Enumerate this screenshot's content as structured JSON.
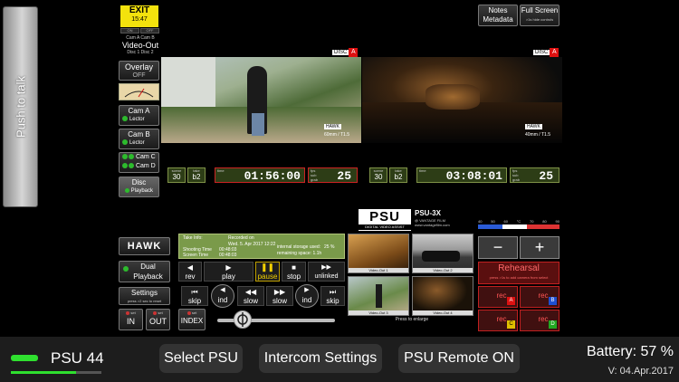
{
  "ptt": {
    "label": "Push to talk"
  },
  "exit": {
    "label": "EXIT",
    "time": "15:47",
    "toggles": [
      "ON",
      "OFF"
    ]
  },
  "notes_button": {
    "line1": "Notes",
    "line2": "Metadata"
  },
  "fullscreen_button": {
    "line1": "Full Screen",
    "line2": ">1s hide controls"
  },
  "left_panel": {
    "camhdr": {
      "line1": "Cam A  Cam B",
      "line2": "Video-Out",
      "line3": "Disc 1   Disc 2"
    },
    "overlay": {
      "label": "Overlay",
      "state": "OFF"
    },
    "cam_a": {
      "label": "Cam A",
      "sub": "Lector"
    },
    "cam_b": {
      "label": "Cam B",
      "sub": "Lector"
    },
    "cam_cd": {
      "c": "Cam C",
      "d": "Cam D"
    },
    "disc": {
      "label": "Disc",
      "sub": "Playback"
    }
  },
  "videos": {
    "left": {
      "disc_label": "DISC",
      "disc_letter": "A",
      "lens": "60mm / T1.5",
      "brand": "HAWK"
    },
    "right": {
      "disc_label": "DISC",
      "disc_letter": "A",
      "lens": "40mm / T1.5",
      "brand": "HAWK"
    }
  },
  "tc_left": {
    "scene_label": "scene",
    "scene": "30",
    "take_label": "take",
    "take": "b2",
    "time_label": "time",
    "timecode": "01:56:00",
    "fps_label": "fps",
    "fps_sub": "sub",
    "fps_sub2": "grab",
    "fps": "25"
  },
  "tc_right": {
    "scene_label": "scene",
    "scene": "30",
    "take_label": "take",
    "take": "b2",
    "time_label": "time",
    "timecode": "03:08:01",
    "fps_label": "fps",
    "fps_sub": "sub",
    "fps_sub2": "grab",
    "fps": "25"
  },
  "psu_logo": {
    "brand": "PSU",
    "sub": "DIGITAL VIDEO ASSIST",
    "model": "PSU-3X",
    "by": "@ VANTAGE FILM",
    "url": "www.vantagefilm.com"
  },
  "temp_scale": {
    "ticks": [
      "40",
      "50",
      "60",
      "°C",
      "70",
      "80",
      "90"
    ]
  },
  "take_info": {
    "title": "Take Info:",
    "recorded_on": "Recorded on",
    "date": "Wed. 5. Apr 2017  12:22",
    "shooting_label": "Shooting Time",
    "shooting": "00:48:03",
    "screen_label": "Screen Time",
    "screen": "00:48:03",
    "storage_label": "internal storage used:",
    "storage": "25 %",
    "storage_remain": "remaining space: 1.1h"
  },
  "hawk_button": {
    "label": "HAWK"
  },
  "dual_playback": {
    "line1": "Dual",
    "line2": "Playback"
  },
  "settings_button": {
    "label": "Settings",
    "sub": "press >2 sec to reset"
  },
  "set_in": {
    "set": "set",
    "label": "IN"
  },
  "set_out": {
    "set": "set",
    "label": "OUT"
  },
  "set_index": {
    "set": "set",
    "label": "INDEX"
  },
  "transport_row1": [
    {
      "icon": "◀",
      "label": "rev"
    },
    {
      "icon": "▶",
      "label": "play"
    },
    {
      "icon": "❚❚",
      "label": "pause"
    },
    {
      "icon": "■",
      "label": "stop"
    },
    {
      "icon": "▶▶",
      "label": "unlinked"
    }
  ],
  "transport_row2": [
    {
      "icon": "⏮",
      "label": "skip"
    },
    {
      "icon": "◀",
      "label": "ind"
    },
    {
      "icon": "◀◀",
      "label": "slow"
    },
    {
      "icon": "▶▶",
      "label": "slow"
    },
    {
      "icon": "▶",
      "label": "ind"
    },
    {
      "icon": "⏭",
      "label": "skip"
    }
  ],
  "thumbs": [
    {
      "label": "Video-Out 1"
    },
    {
      "label": "Video-Out 2"
    },
    {
      "label": "Video-Out 3"
    },
    {
      "label": "Video-Out 4"
    }
  ],
  "press_enlarge": "Press to enlarge",
  "plusminus": {
    "minus": "−",
    "plus": "+"
  },
  "rehearsal": {
    "label": "Rehearsal",
    "sub": "press >1s to add camera from select"
  },
  "rec_buttons": [
    {
      "text": "rec",
      "letter": "A",
      "color": "#d11"
    },
    {
      "text": "rec",
      "letter": "B",
      "color": "#1e4fd0"
    },
    {
      "text": "rec",
      "letter": "C",
      "color": "#e0c000"
    },
    {
      "text": "rec",
      "letter": "D",
      "color": "#21a821"
    }
  ],
  "bottom": {
    "psu_label": "PSU 44",
    "select_psu": "Select PSU",
    "intercom": "Intercom Settings",
    "remote": "PSU Remote ON",
    "battery": "Battery: 57 %",
    "version": "V: 04.Apr.2017"
  }
}
